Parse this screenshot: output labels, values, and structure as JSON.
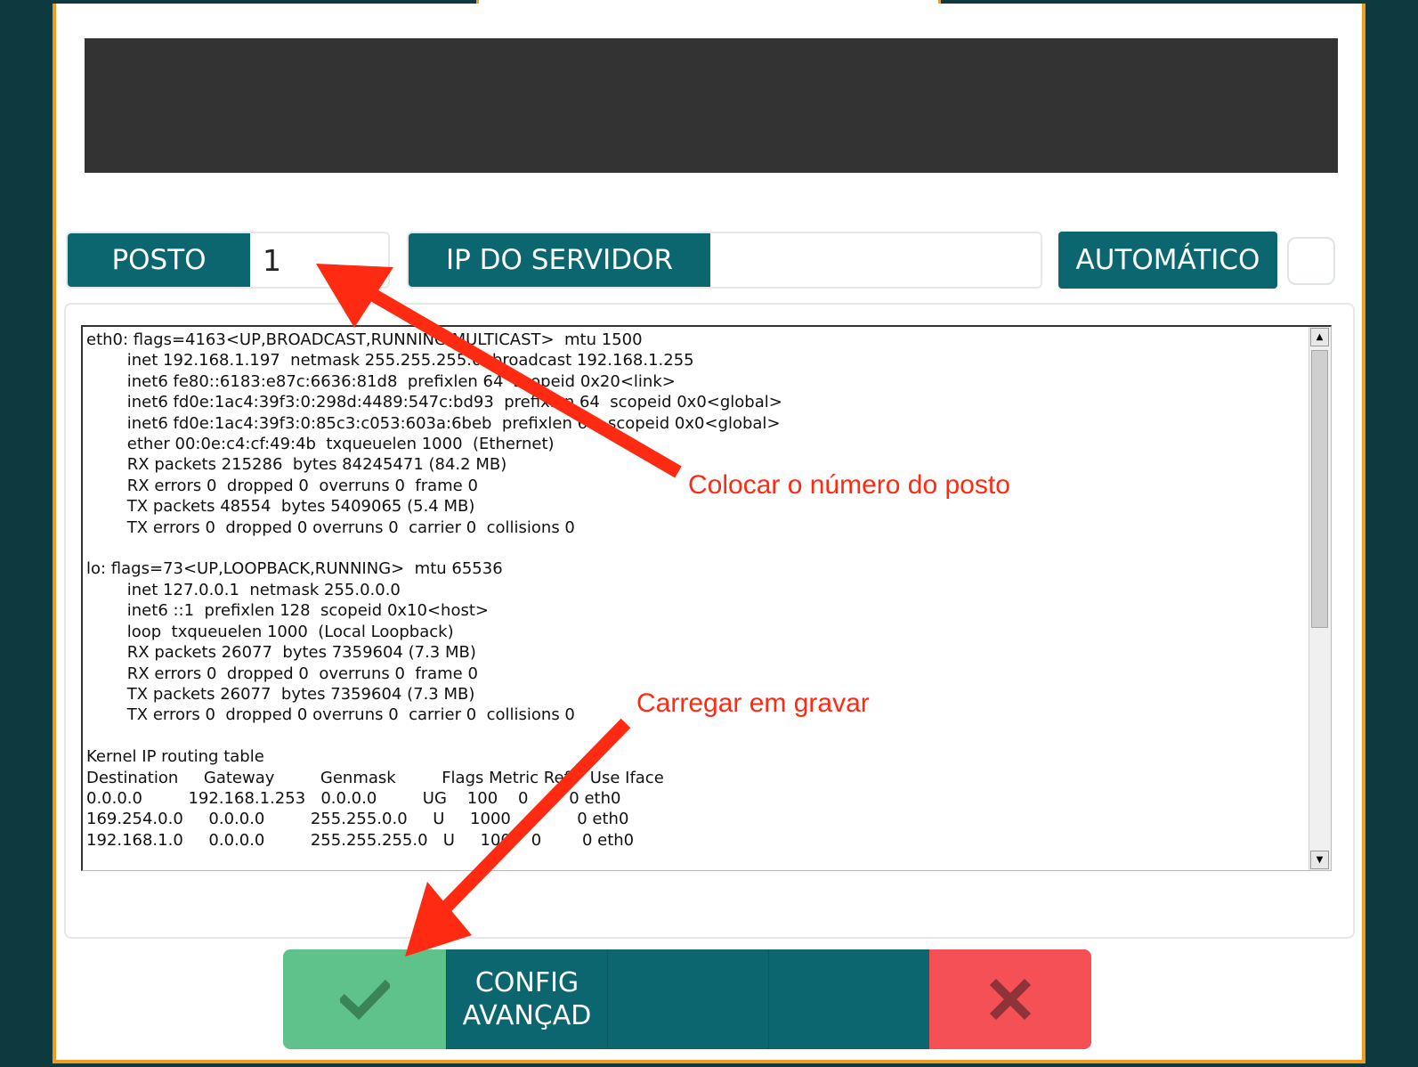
{
  "form": {
    "posto_label": "POSTO",
    "posto_value": "1",
    "ip_label": "IP DO SERVIDOR",
    "ip_value": "",
    "auto_label": "AUTOMÁTICO"
  },
  "terminal": {
    "output": "eth0: flags=4163<UP,BROADCAST,RUNNING,MULTICAST>  mtu 1500\n        inet 192.168.1.197  netmask 255.255.255.0  broadcast 192.168.1.255\n        inet6 fe80::6183:e87c:6636:81d8  prefixlen 64  scopeid 0x20<link>\n        inet6 fd0e:1ac4:39f3:0:298d:4489:547c:bd93  prefixlen 64  scopeid 0x0<global>\n        inet6 fd0e:1ac4:39f3:0:85c3:c053:603a:6beb  prefixlen 64  scopeid 0x0<global>\n        ether 00:0e:c4:cf:49:4b  txqueuelen 1000  (Ethernet)\n        RX packets 215286  bytes 84245471 (84.2 MB)\n        RX errors 0  dropped 0  overruns 0  frame 0\n        TX packets 48554  bytes 5409065 (5.4 MB)\n        TX errors 0  dropped 0 overruns 0  carrier 0  collisions 0\n\nlo: flags=73<UP,LOOPBACK,RUNNING>  mtu 65536\n        inet 127.0.0.1  netmask 255.0.0.0\n        inet6 ::1  prefixlen 128  scopeid 0x10<host>\n        loop  txqueuelen 1000  (Local Loopback)\n        RX packets 26077  bytes 7359604 (7.3 MB)\n        RX errors 0  dropped 0  overruns 0  frame 0\n        TX packets 26077  bytes 7359604 (7.3 MB)\n        TX errors 0  dropped 0 overruns 0  carrier 0  collisions 0\n\nKernel IP routing table\nDestination     Gateway         Genmask         Flags Metric Ref    Use Iface\n0.0.0.0         192.168.1.253   0.0.0.0         UG    100    0        0 eth0\n169.254.0.0     0.0.0.0         255.255.0.0     U     1000   0        0 eth0\n192.168.1.0     0.0.0.0         255.255.255.0   U     100    0        0 eth0"
  },
  "buttons": {
    "config_label": "CONFIG\nAVANÇAD",
    "confirm_icon": "check-icon",
    "cancel_icon": "x-icon"
  },
  "annotations": {
    "posto_hint": "Colocar o número do posto",
    "save_hint": "Carregar em gravar",
    "arrow_color": "#ff2a12"
  },
  "colors": {
    "accent": "#0c6670",
    "frame_border": "#f39a1f",
    "confirm": "#5fc28a",
    "cancel": "#f55055",
    "background": "#0c3a3f"
  }
}
